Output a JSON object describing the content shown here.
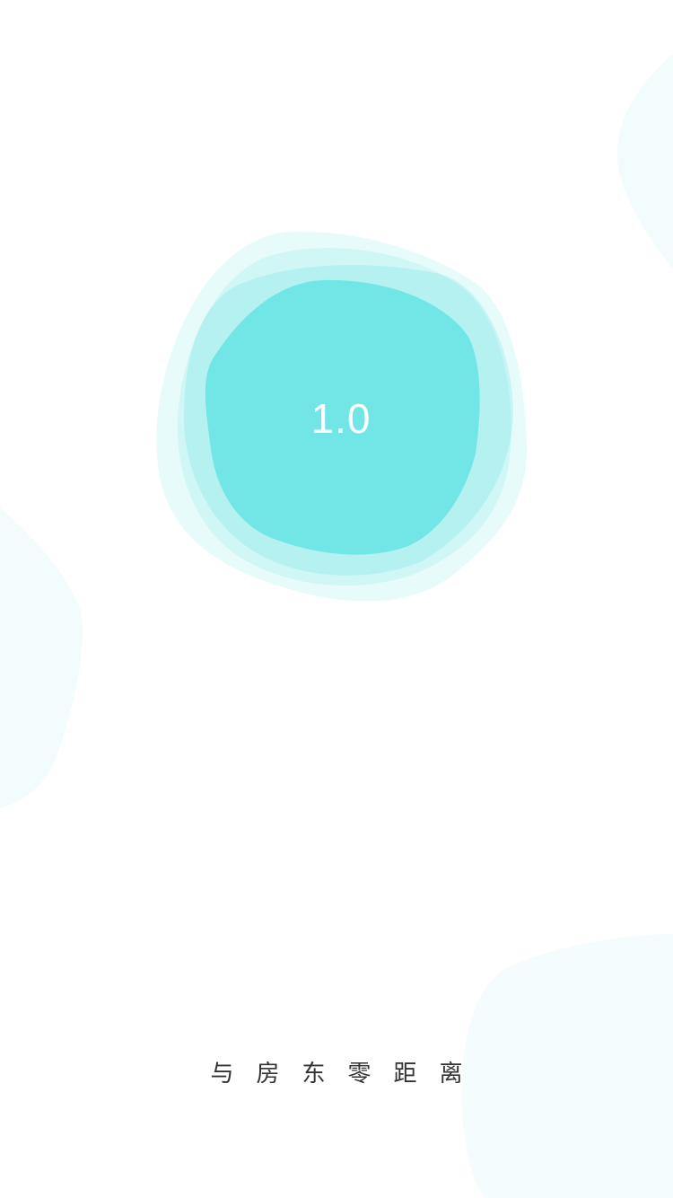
{
  "splash": {
    "version": "1.0",
    "tagline": "与房东零距离"
  },
  "colors": {
    "blob_core": "#72E6E6",
    "blob_layer": "#C8F4F4",
    "background_blob": "#F3FCFD",
    "tagline_text": "#333333",
    "version_text": "#FFFFFF"
  }
}
